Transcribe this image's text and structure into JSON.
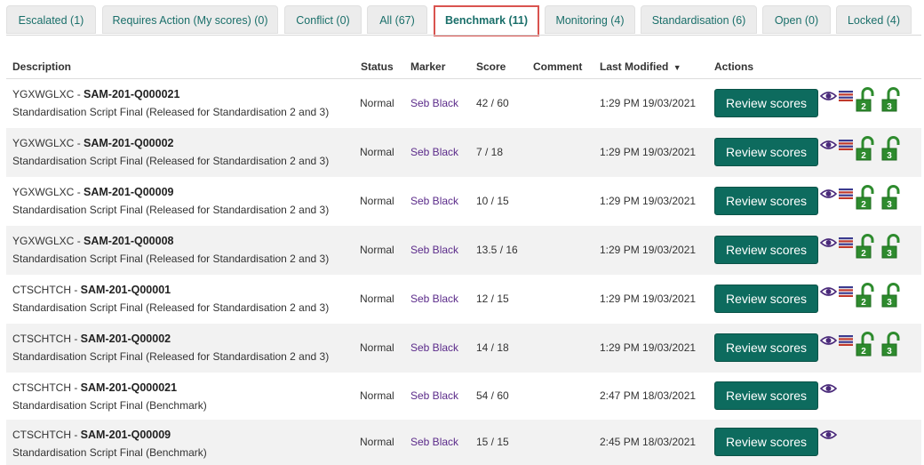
{
  "tabs": [
    {
      "label": "Escalated (1)"
    },
    {
      "label": "Requires Action (My scores) (0)"
    },
    {
      "label": "Conflict (0)"
    },
    {
      "label": "All (67)"
    },
    {
      "label": "Benchmark (11)"
    },
    {
      "label": "Monitoring (4)"
    },
    {
      "label": "Standardisation (6)"
    },
    {
      "label": "Open (0)"
    },
    {
      "label": "Locked (4)"
    }
  ],
  "active_tab": "Benchmark (11)",
  "columns": {
    "description": "Description",
    "status": "Status",
    "marker": "Marker",
    "score": "Score",
    "comment": "Comment",
    "last_modified": "Last Modified",
    "sort_icon": "▼",
    "actions": "Actions"
  },
  "rows": [
    {
      "candidate": "YGXWGLXC",
      "sep": " - ",
      "script_id": "SAM-201-Q000021",
      "desc": "Standardisation Script Final (Released for Standardisation 2 and 3)",
      "status": "Normal",
      "marker": "Seb Black",
      "score": "42 / 60",
      "comment": "",
      "modified": "1:29 PM 19/03/2021",
      "button": "Review scores",
      "icons": [
        "eye-icon",
        "list-icon",
        "unlock-2-icon",
        "unlock-3-icon"
      ]
    },
    {
      "candidate": "YGXWGLXC",
      "sep": " - ",
      "script_id": "SAM-201-Q00002",
      "desc": "Standardisation Script Final (Released for Standardisation 2 and 3)",
      "status": "Normal",
      "marker": "Seb Black",
      "score": "7 / 18",
      "comment": "",
      "modified": "1:29 PM 19/03/2021",
      "button": "Review scores",
      "icons": [
        "eye-icon",
        "list-icon",
        "unlock-2-icon",
        "unlock-3-icon"
      ]
    },
    {
      "candidate": "YGXWGLXC",
      "sep": " - ",
      "script_id": "SAM-201-Q00009",
      "desc": "Standardisation Script Final (Released for Standardisation 2 and 3)",
      "status": "Normal",
      "marker": "Seb Black",
      "score": "10 / 15",
      "comment": "",
      "modified": "1:29 PM 19/03/2021",
      "button": "Review scores",
      "icons": [
        "eye-icon",
        "list-icon",
        "unlock-2-icon",
        "unlock-3-icon"
      ]
    },
    {
      "candidate": "YGXWGLXC",
      "sep": " - ",
      "script_id": "SAM-201-Q00008",
      "desc": "Standardisation Script Final (Released for Standardisation 2 and 3)",
      "status": "Normal",
      "marker": "Seb Black",
      "score": "13.5 / 16",
      "comment": "",
      "modified": "1:29 PM 19/03/2021",
      "button": "Review scores",
      "icons": [
        "eye-icon",
        "list-icon",
        "unlock-2-icon",
        "unlock-3-icon"
      ]
    },
    {
      "candidate": "CTSCHTCH",
      "sep": " - ",
      "script_id": "SAM-201-Q00001",
      "desc": "Standardisation Script Final (Released for Standardisation 2 and 3)",
      "status": "Normal",
      "marker": "Seb Black",
      "score": "12 / 15",
      "comment": "",
      "modified": "1:29 PM 19/03/2021",
      "button": "Review scores",
      "icons": [
        "eye-icon",
        "list-icon",
        "unlock-2-icon",
        "unlock-3-icon"
      ]
    },
    {
      "candidate": "CTSCHTCH",
      "sep": " - ",
      "script_id": "SAM-201-Q00002",
      "desc": "Standardisation Script Final (Released for Standardisation 2 and 3)",
      "status": "Normal",
      "marker": "Seb Black",
      "score": "14 / 18",
      "comment": "",
      "modified": "1:29 PM 19/03/2021",
      "button": "Review scores",
      "icons": [
        "eye-icon",
        "list-icon",
        "unlock-2-icon",
        "unlock-3-icon"
      ]
    },
    {
      "candidate": "CTSCHTCH",
      "sep": " - ",
      "script_id": "SAM-201-Q000021",
      "desc": "Standardisation Script Final (Benchmark)",
      "status": "Normal",
      "marker": "Seb Black",
      "score": "54 / 60",
      "comment": "",
      "modified": "2:47 PM 18/03/2021",
      "button": "Review scores",
      "icons": [
        "eye-icon"
      ]
    },
    {
      "candidate": "CTSCHTCH",
      "sep": " - ",
      "script_id": "SAM-201-Q00009",
      "desc": "Standardisation Script Final (Benchmark)",
      "status": "Normal",
      "marker": "Seb Black",
      "score": "15 / 15",
      "comment": "",
      "modified": "2:45 PM 18/03/2021",
      "button": "Review scores",
      "icons": [
        "eye-icon"
      ]
    }
  ],
  "colors": {
    "accent": "#0d6b5e",
    "tab_text": "#1a6f6a",
    "active_border": "#d9534f",
    "marker_link": "#5b2b8a",
    "unlock_green": "#2e8b2e",
    "row_alt": "#f2f2f2"
  }
}
